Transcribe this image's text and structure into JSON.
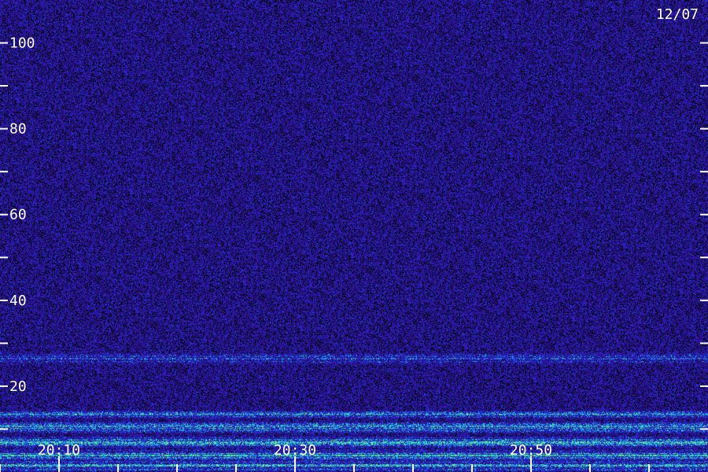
{
  "date_label": "12/07",
  "chart_data": {
    "type": "heatmap",
    "title": "",
    "xlabel": "",
    "ylabel": "",
    "ylim": [
      0,
      110
    ],
    "y_major_ticks": [
      20,
      40,
      60,
      80,
      100
    ],
    "y_minor_ticks": [
      10,
      30,
      50,
      70,
      90
    ],
    "y_tick_labels": [
      "20",
      "40",
      "60",
      "80",
      "100"
    ],
    "x_range": [
      "20:05",
      "21:05"
    ],
    "x_major_ticks": [
      "20:10",
      "20:30",
      "20:50"
    ],
    "x_minor_ticks": [
      "20:05",
      "20:15",
      "20:20",
      "20:25",
      "20:35",
      "20:40",
      "20:45",
      "20:55",
      "21:00"
    ],
    "x_tick_labels": [
      "20:10",
      "20:30",
      "20:50"
    ],
    "noise_floor_color": "#2a13a0",
    "band_colors": [
      "#1a3fe0",
      "#19b8e8",
      "#2ee6a8",
      "#7cff7c"
    ],
    "bands": [
      {
        "center": 26.5,
        "width": 1.5,
        "intensity": 0.35
      },
      {
        "center": 13.5,
        "width": 1.0,
        "intensity": 0.55
      },
      {
        "center": 10.5,
        "width": 1.5,
        "intensity": 0.65
      },
      {
        "center": 7.0,
        "width": 1.5,
        "intensity": 0.7
      },
      {
        "center": 4.0,
        "width": 1.5,
        "intensity": 0.75
      },
      {
        "center": 1.5,
        "width": 1.5,
        "intensity": 0.7
      }
    ]
  }
}
